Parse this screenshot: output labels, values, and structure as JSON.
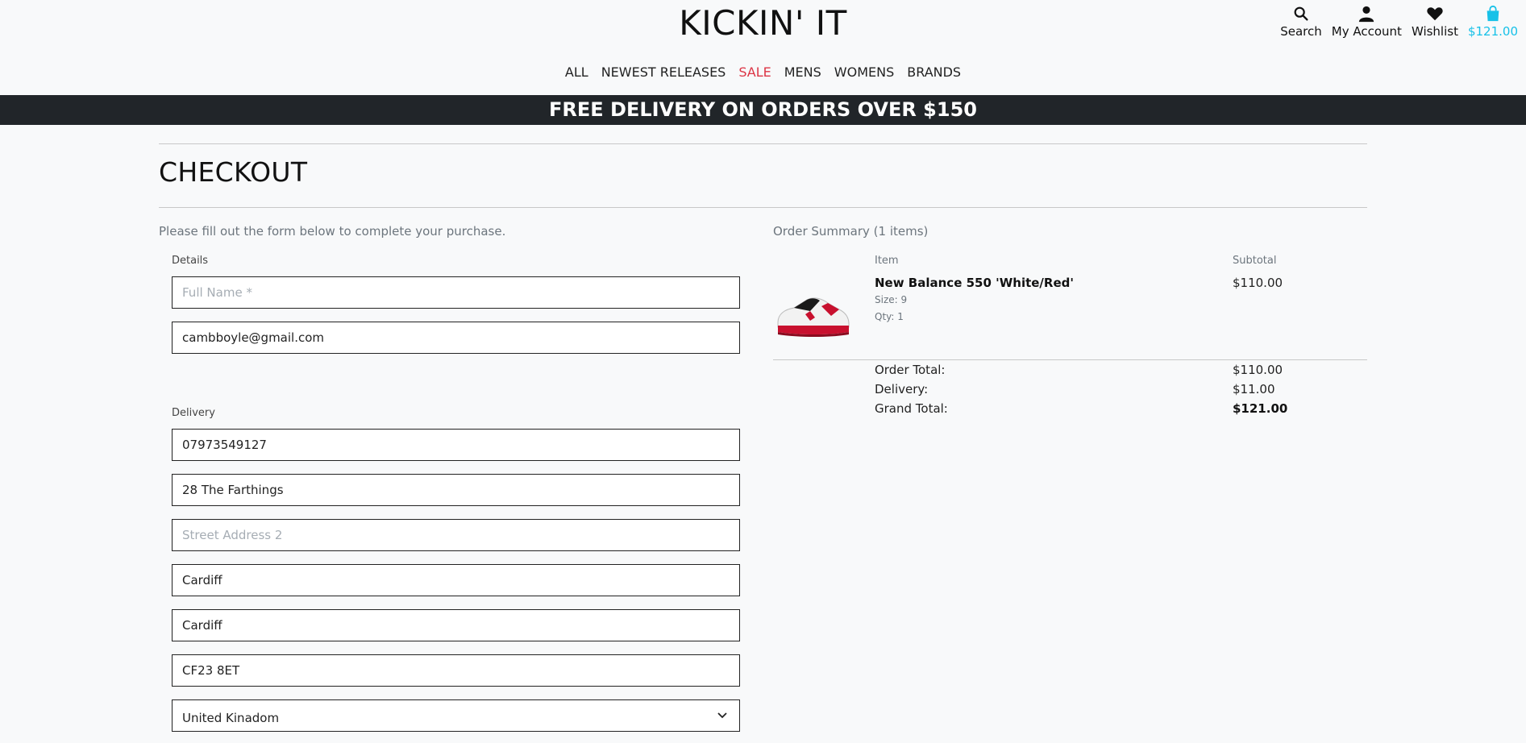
{
  "brand": "KICKIN' IT",
  "tools": {
    "search": "Search",
    "account": "My Account",
    "wishlist": "Wishlist",
    "bag_total": "$121.00"
  },
  "nav": [
    "ALL",
    "NEWEST RELEASES",
    "SALE",
    "MENS",
    "WOMENS",
    "BRANDS"
  ],
  "banner": "FREE DELIVERY ON ORDERS OVER $150",
  "checkout": {
    "title": "CHECKOUT",
    "intro": "Please fill out the form below to complete your purchase.",
    "details_label": "Details",
    "delivery_label": "Delivery",
    "fields": {
      "full_name": {
        "value": "",
        "placeholder": "Full Name *"
      },
      "email": {
        "value": "cambboyle@gmail.com"
      },
      "phone": {
        "value": "07973549127"
      },
      "street1": {
        "value": "28 The Farthings"
      },
      "street2": {
        "value": "",
        "placeholder": "Street Address 2"
      },
      "town": {
        "value": "Cardiff"
      },
      "county": {
        "value": "Cardiff"
      },
      "postcode": {
        "value": "CF23 8ET"
      },
      "country": {
        "value": "United Kinadom"
      }
    }
  },
  "summary": {
    "heading": "Order Summary (1 items)",
    "col_item": "Item",
    "col_subtotal": "Subtotal",
    "item": {
      "name": "New Balance 550 'White/Red'",
      "size": "Size: 9",
      "qty": "Qty: 1",
      "subtotal": "$110.00"
    },
    "order_total_label": "Order Total:",
    "order_total": "$110.00",
    "delivery_label": "Delivery:",
    "delivery": "$11.00",
    "grand_total_label": "Grand Total:",
    "grand_total": "$121.00"
  },
  "colors": {
    "accent": "#17c1e8",
    "sale": "#dc3545",
    "banner_bg": "#212529"
  }
}
